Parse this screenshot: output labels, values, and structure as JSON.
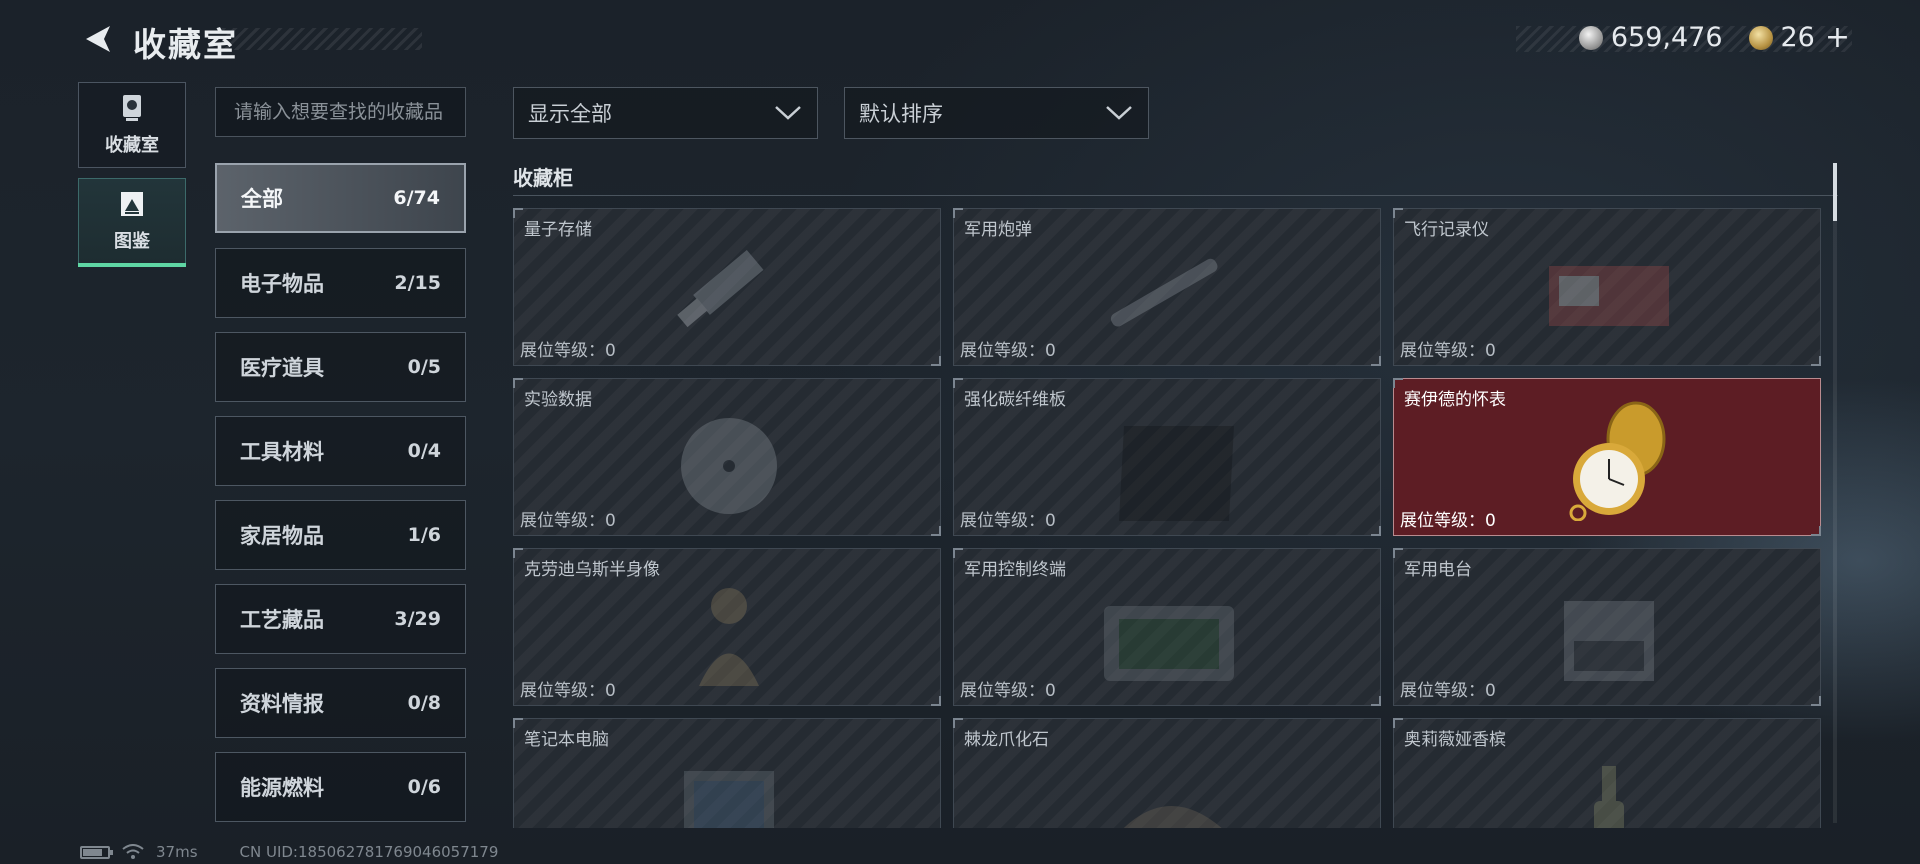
{
  "header": {
    "title": "收藏室",
    "currency_1": "659,476",
    "currency_2": "26",
    "plus": "+"
  },
  "nav": [
    {
      "label": "收藏室",
      "active": false
    },
    {
      "label": "图鉴",
      "active": true
    }
  ],
  "search": {
    "placeholder": "请输入想要查找的收藏品"
  },
  "categories": [
    {
      "name": "全部",
      "count": "6/74",
      "active": true
    },
    {
      "name": "电子物品",
      "count": "2/15"
    },
    {
      "name": "医疗道具",
      "count": "0/5"
    },
    {
      "name": "工具材料",
      "count": "0/4"
    },
    {
      "name": "家居物品",
      "count": "1/6"
    },
    {
      "name": "工艺藏品",
      "count": "3/29"
    },
    {
      "name": "资料情报",
      "count": "0/8"
    },
    {
      "name": "能源燃料",
      "count": "0/6"
    }
  ],
  "filters": {
    "display": "显示全部",
    "sort": "默认排序"
  },
  "cabinet": {
    "title": "收藏柜",
    "items": [
      {
        "name": "量子存储",
        "level": "展位等级：0",
        "icon": "usb-drive-icon"
      },
      {
        "name": "军用炮弹",
        "level": "展位等级：0",
        "icon": "shell-icon"
      },
      {
        "name": "飞行记录仪",
        "level": "展位等级：0",
        "icon": "flight-recorder-icon"
      },
      {
        "name": "实验数据",
        "level": "展位等级：0",
        "icon": "disc-icon"
      },
      {
        "name": "强化碳纤维板",
        "level": "展位等级：0",
        "icon": "carbon-plate-icon"
      },
      {
        "name": "赛伊德的怀表",
        "level": "展位等级：0",
        "icon": "pocket-watch-icon",
        "owned": true
      },
      {
        "name": "克劳迪乌斯半身像",
        "level": "展位等级：0",
        "icon": "bust-icon"
      },
      {
        "name": "军用控制终端",
        "level": "展位等级：0",
        "icon": "terminal-icon"
      },
      {
        "name": "军用电台",
        "level": "展位等级：0",
        "icon": "radio-icon"
      },
      {
        "name": "笔记本电脑",
        "level": "",
        "icon": "laptop-icon"
      },
      {
        "name": "棘龙爪化石",
        "level": "",
        "icon": "fossil-icon"
      },
      {
        "name": "奥莉薇娅香槟",
        "level": "",
        "icon": "champagne-icon"
      }
    ]
  },
  "status": {
    "ping": "37ms",
    "uid": "CN UID:1850627817690460571​79"
  },
  "colors": {
    "accent": "#5fd6a4",
    "owned_bg": "#5d1d24",
    "bg": "#1d252d"
  }
}
